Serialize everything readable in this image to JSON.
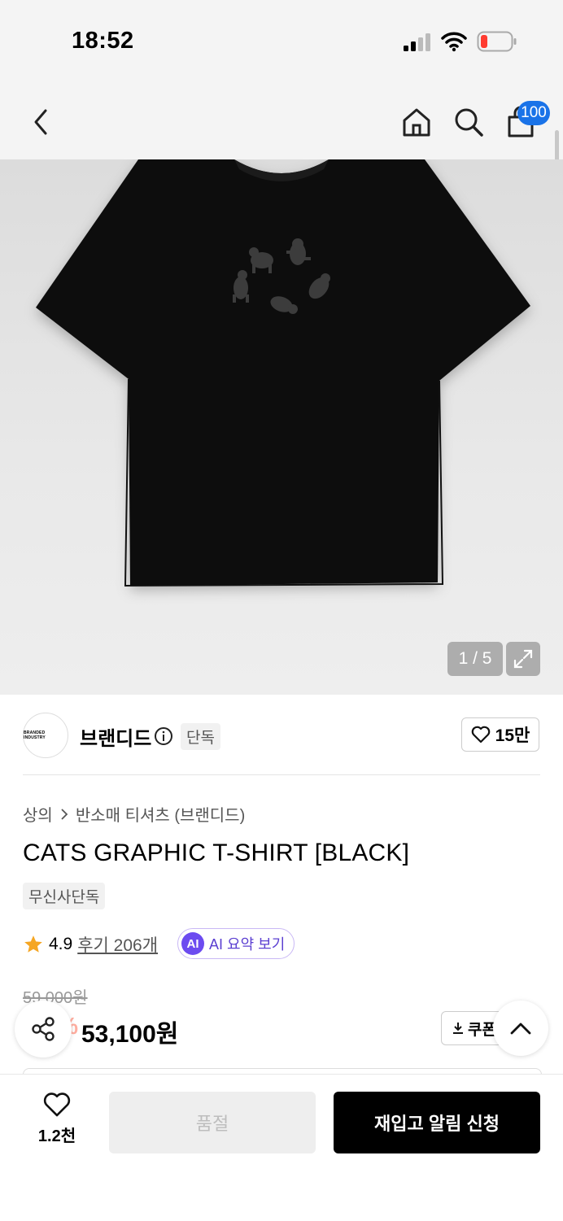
{
  "status_bar": {
    "time": "18:52"
  },
  "nav": {
    "cart_count": "100"
  },
  "gallery": {
    "counter": "1 / 5"
  },
  "brand": {
    "logo_text": "BRANDED INDUSTRY",
    "name": "브랜디드",
    "exclusive_tag": "단독",
    "likes": "15만"
  },
  "breadcrumb": {
    "category": "상의",
    "subcategory": "반소매 티셔츠 (브랜디드)"
  },
  "product": {
    "title": "CATS GRAPHIC T-SHIRT [BLACK]",
    "exclusive_label": "무신사단독",
    "rating": "4.9",
    "review_label": "후기 206개",
    "ai_icon": "AI",
    "ai_label": "AI 요약 보기",
    "original_price": "59,000원",
    "discount": "10%",
    "price": "53,100원",
    "coupon_label": "쿠폰 받기"
  },
  "bottom_bar": {
    "wish_count": "1.2천",
    "soldout_label": "품절",
    "restock_label": "재입고 알림 신청"
  }
}
